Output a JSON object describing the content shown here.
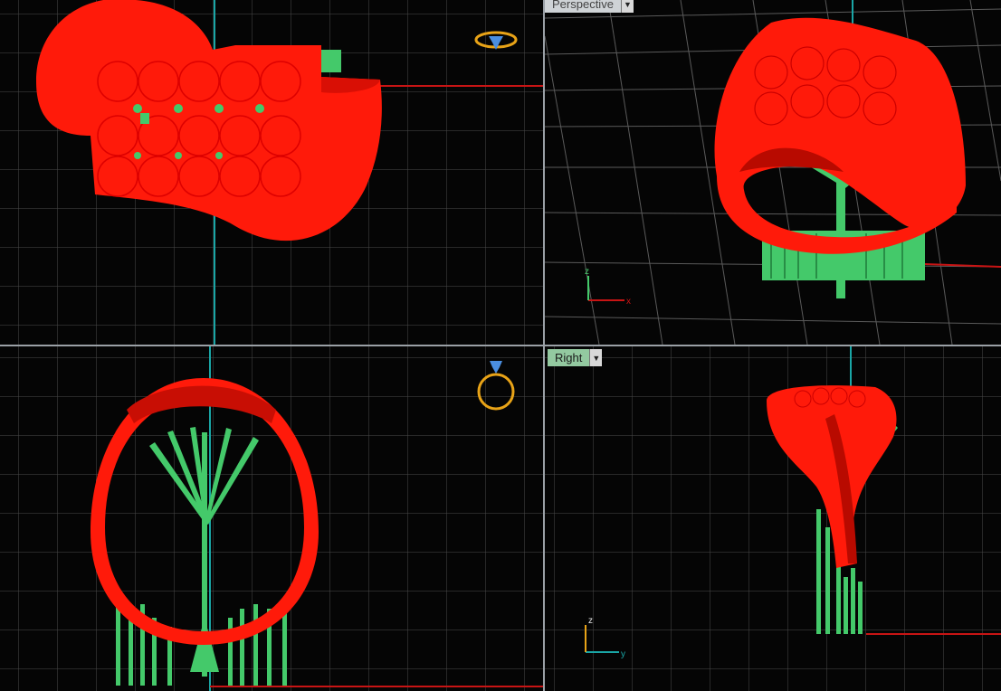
{
  "viewports": {
    "perspective": {
      "label": "Perspective"
    },
    "right": {
      "label": "Right"
    }
  },
  "axes": {
    "perspective": {
      "z": "z",
      "x": "x"
    },
    "right": {
      "z": "z",
      "y": "y"
    }
  },
  "colors": {
    "background": "#050505",
    "grid_minor": "#3a3a3a",
    "grid_major": "#6a6a6a",
    "model": "#ff1a0a",
    "supports": "#44c96a",
    "axis_red": "#c81414",
    "axis_cyan": "#1aa6a6",
    "gizmo_gold": "#e8a317",
    "gizmo_blue": "#4a8ee0"
  },
  "icons": {
    "top_gizmo": "ring-top-view-icon",
    "front_gizmo": "ring-front-view-icon"
  }
}
